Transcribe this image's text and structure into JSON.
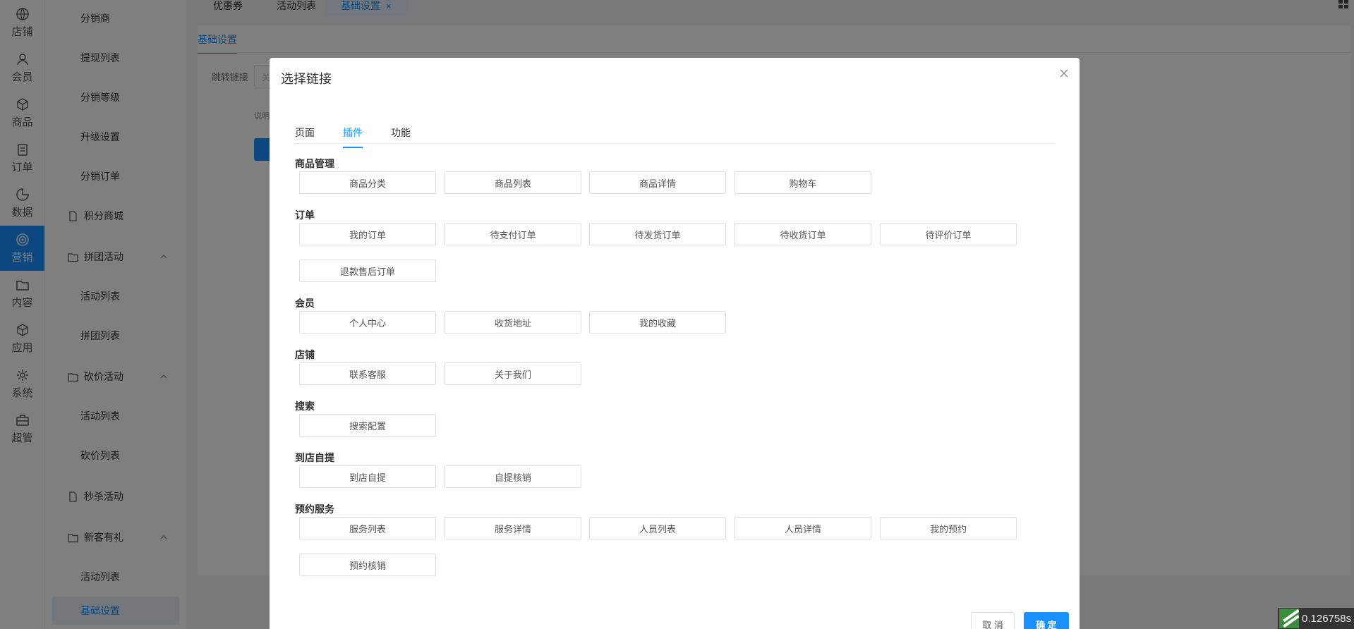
{
  "rail": [
    {
      "label": "店铺",
      "icon": "globe-icon"
    },
    {
      "label": "会员",
      "icon": "user-icon"
    },
    {
      "label": "商品",
      "icon": "box-icon"
    },
    {
      "label": "订单",
      "icon": "clipboard-icon"
    },
    {
      "label": "数据",
      "icon": "pie-chart-icon"
    },
    {
      "label": "营销",
      "icon": "target-icon"
    },
    {
      "label": "内容",
      "icon": "folder-icon"
    },
    {
      "label": "应用",
      "icon": "cube-icon"
    },
    {
      "label": "系统",
      "icon": "gear-icon"
    },
    {
      "label": "超管",
      "icon": "briefcase-icon"
    }
  ],
  "submenu": [
    {
      "label": "分销商",
      "kind": "child"
    },
    {
      "label": "提现列表",
      "kind": "child"
    },
    {
      "label": "分销等级",
      "kind": "child"
    },
    {
      "label": "升级设置",
      "kind": "child"
    },
    {
      "label": "分销订单",
      "kind": "child"
    },
    {
      "label": "积分商城",
      "kind": "parent-file"
    },
    {
      "label": "拼团活动",
      "kind": "parent-folder"
    },
    {
      "label": "活动列表",
      "kind": "child"
    },
    {
      "label": "拼团列表",
      "kind": "child"
    },
    {
      "label": "砍价活动",
      "kind": "parent-folder"
    },
    {
      "label": "活动列表",
      "kind": "child"
    },
    {
      "label": "砍价列表",
      "kind": "child"
    },
    {
      "label": "秒杀活动",
      "kind": "parent-file"
    },
    {
      "label": "新客有礼",
      "kind": "parent-folder"
    },
    {
      "label": "活动列表",
      "kind": "child"
    },
    {
      "label": "基础设置",
      "kind": "selected"
    }
  ],
  "top_tabs": [
    {
      "label": "优惠券"
    },
    {
      "label": "活动列表"
    },
    {
      "label": "基础设置",
      "close": "×"
    }
  ],
  "content": {
    "subtab": "基础设置",
    "field_label": "跳转链接",
    "field_value": "关",
    "note_prefix": "说明"
  },
  "modal": {
    "title": "选择链接",
    "tabs": [
      "页面",
      "插件",
      "功能"
    ],
    "groups": [
      {
        "title": "商品管理",
        "links": [
          "商品分类",
          "商品列表",
          "商品详情",
          "购物车"
        ]
      },
      {
        "title": "订单",
        "links": [
          "我的订单",
          "待支付订单",
          "待发货订单",
          "待收货订单",
          "待评价订单",
          "退款售后订单"
        ]
      },
      {
        "title": "会员",
        "links": [
          "个人中心",
          "收货地址",
          "我的收藏"
        ]
      },
      {
        "title": "店铺",
        "links": [
          "联系客服",
          "关于我们"
        ]
      },
      {
        "title": "搜索",
        "links": [
          "搜索配置"
        ]
      },
      {
        "title": "到店自提",
        "links": [
          "到店自提",
          "自提核销"
        ]
      },
      {
        "title": "预约服务",
        "links": [
          "服务列表",
          "服务详情",
          "人员列表",
          "人员详情",
          "我的预约",
          "预约核销"
        ]
      }
    ],
    "cancel_label": "取 消",
    "ok_label": "确 定"
  },
  "timing": "0.126758s",
  "colors": {
    "primary": "#1890ff",
    "overlay": "rgba(0,0,0,0.5)"
  }
}
